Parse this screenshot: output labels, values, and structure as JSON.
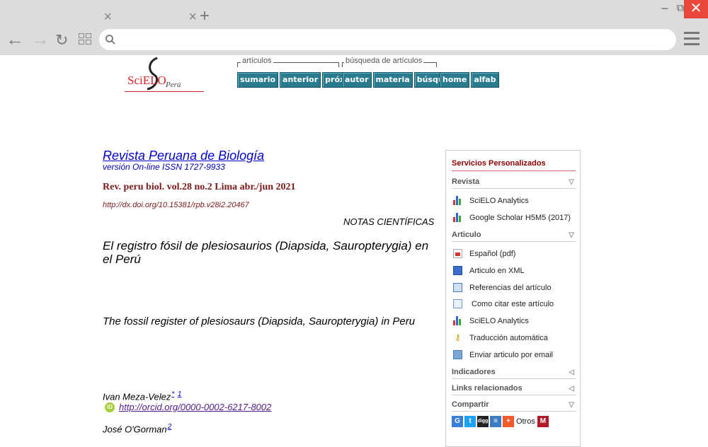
{
  "browser": {
    "new_tab_glyph": "+",
    "tab_close_glyph": "×",
    "minimize_glyph": "−",
    "restore_glyph": "⧉",
    "close_glyph": "✕",
    "back_glyph": "←",
    "forward_glyph": "→",
    "reload_glyph": "↻",
    "address": "",
    "close_color": "#e8473a"
  },
  "logo": {
    "text": "SciELO",
    "country": "Perú"
  },
  "nav": {
    "articulos_title": "artículos",
    "busqueda_title": "búsqueda de artículos",
    "articulos_buttons": [
      "sumario",
      "anterior",
      "próximo"
    ],
    "busqueda_buttons": [
      "autor",
      "materia",
      "búsqueda"
    ],
    "other_buttons": [
      "home",
      "alfab"
    ],
    "button_color": "#2b7b8f"
  },
  "article": {
    "journal": "Revista Peruana de Biología",
    "issn": "versión On-line ISSN 1727-9933",
    "citation": "Rev. peru biol. vol.28 no.2 Lima abr./jun 2021",
    "doi": "http://dx.doi.org/10.15381/rpb.v28i2.20467",
    "section": "NOTAS CIENTÍFICAS",
    "title_es": "El registro fósil de plesiosaurios (Diapsida, Sauropterygia) en el Perú",
    "title_en": "The fossil register of plesiosaurs (Diapsida, Sauropterygia) in Peru",
    "author1": "Ivan Meza-Velez",
    "author1_sup1": "*",
    "author1_sup2": "1",
    "orcid_url": "http://orcid.org/0000-0002-6217-8002",
    "orcid_icon": "iD",
    "author2": "José O'Gorman",
    "author2_sup": "2"
  },
  "sidebar": {
    "title": "Servicios Personalizados",
    "revista_label": "Revista",
    "revista_items": [
      "SciELO Analytics",
      "Google Scholar H5M5 (2017)"
    ],
    "articulo_label": "Articulo",
    "articulo_items": [
      {
        "label": "Español (pdf)",
        "icon": "pdf-icon"
      },
      {
        "label": "Articulo en XML",
        "icon": "xml-icon"
      },
      {
        "label": "Referencias del artículo",
        "icon": "references-icon"
      },
      {
        "label": "Como citar este artículo",
        "icon": "cite-icon"
      },
      {
        "label": "SciELO Analytics",
        "icon": "analytics-icon"
      },
      {
        "label": "Traducción automática",
        "icon": "key-icon"
      },
      {
        "label": "Enviar articulo por email",
        "icon": "email-icon"
      }
    ],
    "indicadores_label": "Indicadores",
    "links_label": "Links relacionados",
    "compartir_label": "Compartir",
    "chevron_down": "▽",
    "chevron_left": "◁",
    "share_icons": [
      {
        "name": "google-icon",
        "glyph": "G",
        "color": "#3b7ddd"
      },
      {
        "name": "twitter-icon",
        "glyph": "t",
        "color": "#1da1f2"
      },
      {
        "name": "digg-icon",
        "glyph": "digg",
        "color": "#222222"
      },
      {
        "name": "list-icon",
        "glyph": "≡",
        "color": "#3a7bc8"
      },
      {
        "name": "addthis-icon",
        "glyph": "+",
        "color": "#f25a29"
      }
    ],
    "otros_label": "Otros",
    "mendeley_glyph": "M",
    "mendeley_color": "#b11a28"
  }
}
